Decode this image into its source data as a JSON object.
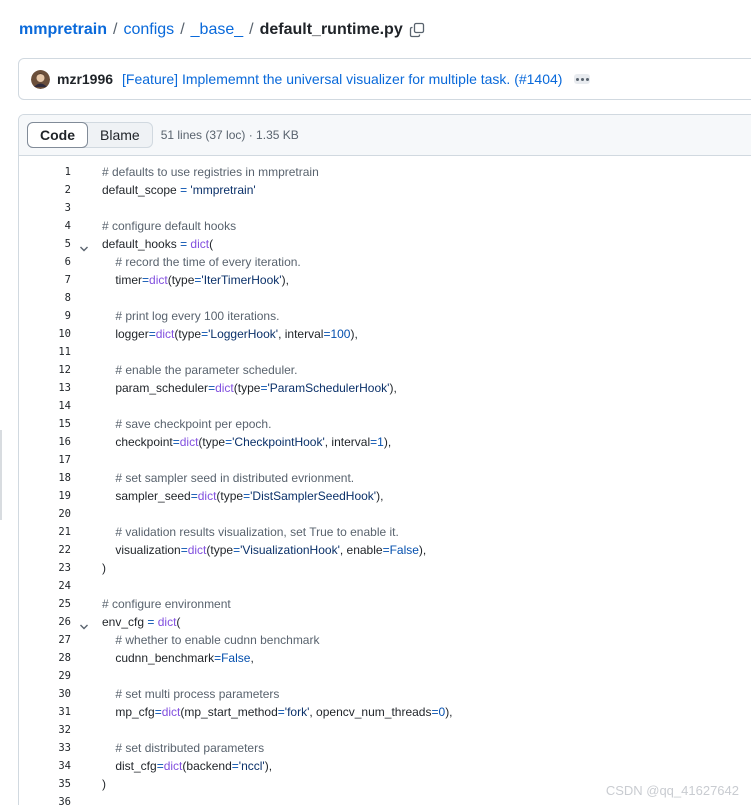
{
  "breadcrumb": {
    "repo": "mmpretrain",
    "parts": [
      "configs",
      "_base_"
    ],
    "separator": "/",
    "file": "default_runtime.py"
  },
  "commit": {
    "author": "mzr1996",
    "message": "[Feature] Implememnt the universal visualizer for multiple task. (#1404)"
  },
  "file_header": {
    "code_tab": "Code",
    "blame_tab": "Blame",
    "meta": "51 lines (37 loc) · 1.35 KB"
  },
  "code_lines": [
    {
      "n": "1",
      "text": "# defaults to use registries in mmpretrain"
    },
    {
      "n": "2",
      "text": "default_scope = 'mmpretrain'"
    },
    {
      "n": "3",
      "text": ""
    },
    {
      "n": "4",
      "text": "# configure default hooks"
    },
    {
      "n": "5",
      "text": "default_hooks = dict(",
      "fold": true
    },
    {
      "n": "6",
      "text": "    # record the time of every iteration."
    },
    {
      "n": "7",
      "text": "    timer=dict(type='IterTimerHook'),"
    },
    {
      "n": "8",
      "text": ""
    },
    {
      "n": "9",
      "text": "    # print log every 100 iterations."
    },
    {
      "n": "10",
      "text": "    logger=dict(type='LoggerHook', interval=100),"
    },
    {
      "n": "11",
      "text": ""
    },
    {
      "n": "12",
      "text": "    # enable the parameter scheduler."
    },
    {
      "n": "13",
      "text": "    param_scheduler=dict(type='ParamSchedulerHook'),"
    },
    {
      "n": "14",
      "text": ""
    },
    {
      "n": "15",
      "text": "    # save checkpoint per epoch."
    },
    {
      "n": "16",
      "text": "    checkpoint=dict(type='CheckpointHook', interval=1),"
    },
    {
      "n": "17",
      "text": ""
    },
    {
      "n": "18",
      "text": "    # set sampler seed in distributed evrionment."
    },
    {
      "n": "19",
      "text": "    sampler_seed=dict(type='DistSamplerSeedHook'),"
    },
    {
      "n": "20",
      "text": ""
    },
    {
      "n": "21",
      "text": "    # validation results visualization, set True to enable it."
    },
    {
      "n": "22",
      "text": "    visualization=dict(type='VisualizationHook', enable=False),"
    },
    {
      "n": "23",
      "text": ")"
    },
    {
      "n": "24",
      "text": ""
    },
    {
      "n": "25",
      "text": "# configure environment"
    },
    {
      "n": "26",
      "text": "env_cfg = dict(",
      "fold": true
    },
    {
      "n": "27",
      "text": "    # whether to enable cudnn benchmark"
    },
    {
      "n": "28",
      "text": "    cudnn_benchmark=False,"
    },
    {
      "n": "29",
      "text": ""
    },
    {
      "n": "30",
      "text": "    # set multi process parameters"
    },
    {
      "n": "31",
      "text": "    mp_cfg=dict(mp_start_method='fork', opencv_num_threads=0),"
    },
    {
      "n": "32",
      "text": ""
    },
    {
      "n": "33",
      "text": "    # set distributed parameters"
    },
    {
      "n": "34",
      "text": "    dist_cfg=dict(backend='nccl'),"
    },
    {
      "n": "35",
      "text": ")"
    },
    {
      "n": "36",
      "text": ""
    }
  ],
  "watermark": "CSDN @qq_41627642",
  "colors": {
    "link": "#0969da",
    "comment": "#59636e",
    "string": "#0a3069",
    "builtin": "#8250df",
    "constant": "#0550ae"
  }
}
